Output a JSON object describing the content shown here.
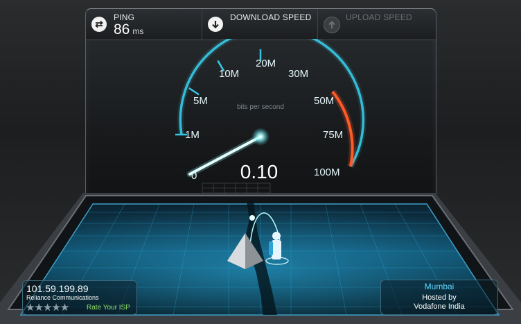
{
  "header": {
    "ping": {
      "label": "PING",
      "value": "86",
      "unit": "ms",
      "icon": "ping-icon"
    },
    "download": {
      "label": "DOWNLOAD SPEED",
      "icon": "arrow-down-icon",
      "state": "active"
    },
    "upload": {
      "label": "UPLOAD SPEED",
      "icon": "arrow-up-icon",
      "state": "inactive"
    }
  },
  "gauge": {
    "unit_label": "bits per second",
    "reading": "0.10",
    "ticks": [
      "0",
      "1M",
      "5M",
      "10M",
      "20M",
      "30M",
      "50M",
      "75M",
      "100M"
    ],
    "needle_position": 0.02,
    "colors": {
      "scale": "#39c4e0",
      "high": "#ff5a2a"
    }
  },
  "isp": {
    "ip": "101.59.199.89",
    "provider": "Reliance Communications",
    "stars": "★★★★★",
    "rate_label": "Rate Your ISP"
  },
  "server": {
    "city": "Mumbai",
    "hosted_by_line1": "Hosted by",
    "hosted_by_line2": "Vodafone India"
  }
}
